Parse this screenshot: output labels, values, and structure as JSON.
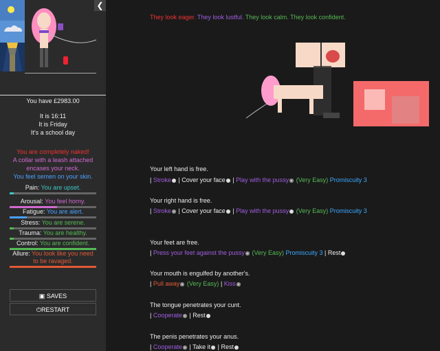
{
  "sidebar": {
    "collapse_icon": "chevron-left-icon",
    "money": "You have £2983.00",
    "time": "It is 16:11",
    "day": "It is Friday",
    "schoolday": "It's a school day",
    "clothing": "You are completely naked!",
    "collar": "A collar with a leash attached encases your neck.",
    "semen": "You feel semen on your skin.",
    "stats": [
      {
        "label": "Pain:",
        "value": "You are upset.",
        "color": "#3dc6c6",
        "bar": 0.05
      },
      {
        "label": "Arousal:",
        "value": "You feel horny.",
        "color": "#d06ad0",
        "bar": 0.55
      },
      {
        "label": "Fatigue:",
        "value": "You are alert.",
        "color": "#4aa0ff",
        "bar": 0.2
      },
      {
        "label": "Stress:",
        "value": "You are serene.",
        "color": "#56b956",
        "bar": 0.05
      },
      {
        "label": "Trauma:",
        "value": "You are healthy.",
        "color": "#56b956",
        "bar": 0.05
      },
      {
        "label": "Control:",
        "value": "You are confident.",
        "color": "#56b956",
        "bar": 1.0
      },
      {
        "label": "Allure:",
        "value": "You look like you need to be ravaged.",
        "color": "#e25a36",
        "bar": 1.0
      }
    ],
    "saves": "SAVES",
    "restart": "RESTART"
  },
  "main": {
    "moods": [
      "They look eager.",
      "They look lustful.",
      "They look calm.",
      "They look confident."
    ],
    "left_hand": "Your left hand is free.",
    "lh": {
      "stroke": "Stroke",
      "cover": "Cover your face",
      "play": "Play with the pussy",
      "diff": "(Very Easy)",
      "prom": "Promiscuity 3"
    },
    "right_hand": "Your right hand is free.",
    "rh": {
      "stroke": "Stroke",
      "cover": "Cover your face",
      "play": "Play with the pussy",
      "diff": "(Very Easy)",
      "prom": "Promiscuity 3"
    },
    "feet": "Your feet are free.",
    "ft": {
      "press": "Press your feet against the pussy",
      "diff": "(Very Easy)",
      "prom": "Promiscuity 3",
      "rest": "Rest"
    },
    "mouth": "Your mouth is engulfed by another's.",
    "mo": {
      "pull": "Pull away",
      "diff": "(Very Easy)",
      "kiss": "Kiss"
    },
    "tongue": "The tongue penetrates your cunt.",
    "to": {
      "coop": "Cooperate",
      "rest": "Rest"
    },
    "penis": "The penis penetrates your anus.",
    "pe": {
      "coop": "Cooperate",
      "take": "Take it",
      "rest": "Rest"
    },
    "sep": "|"
  }
}
